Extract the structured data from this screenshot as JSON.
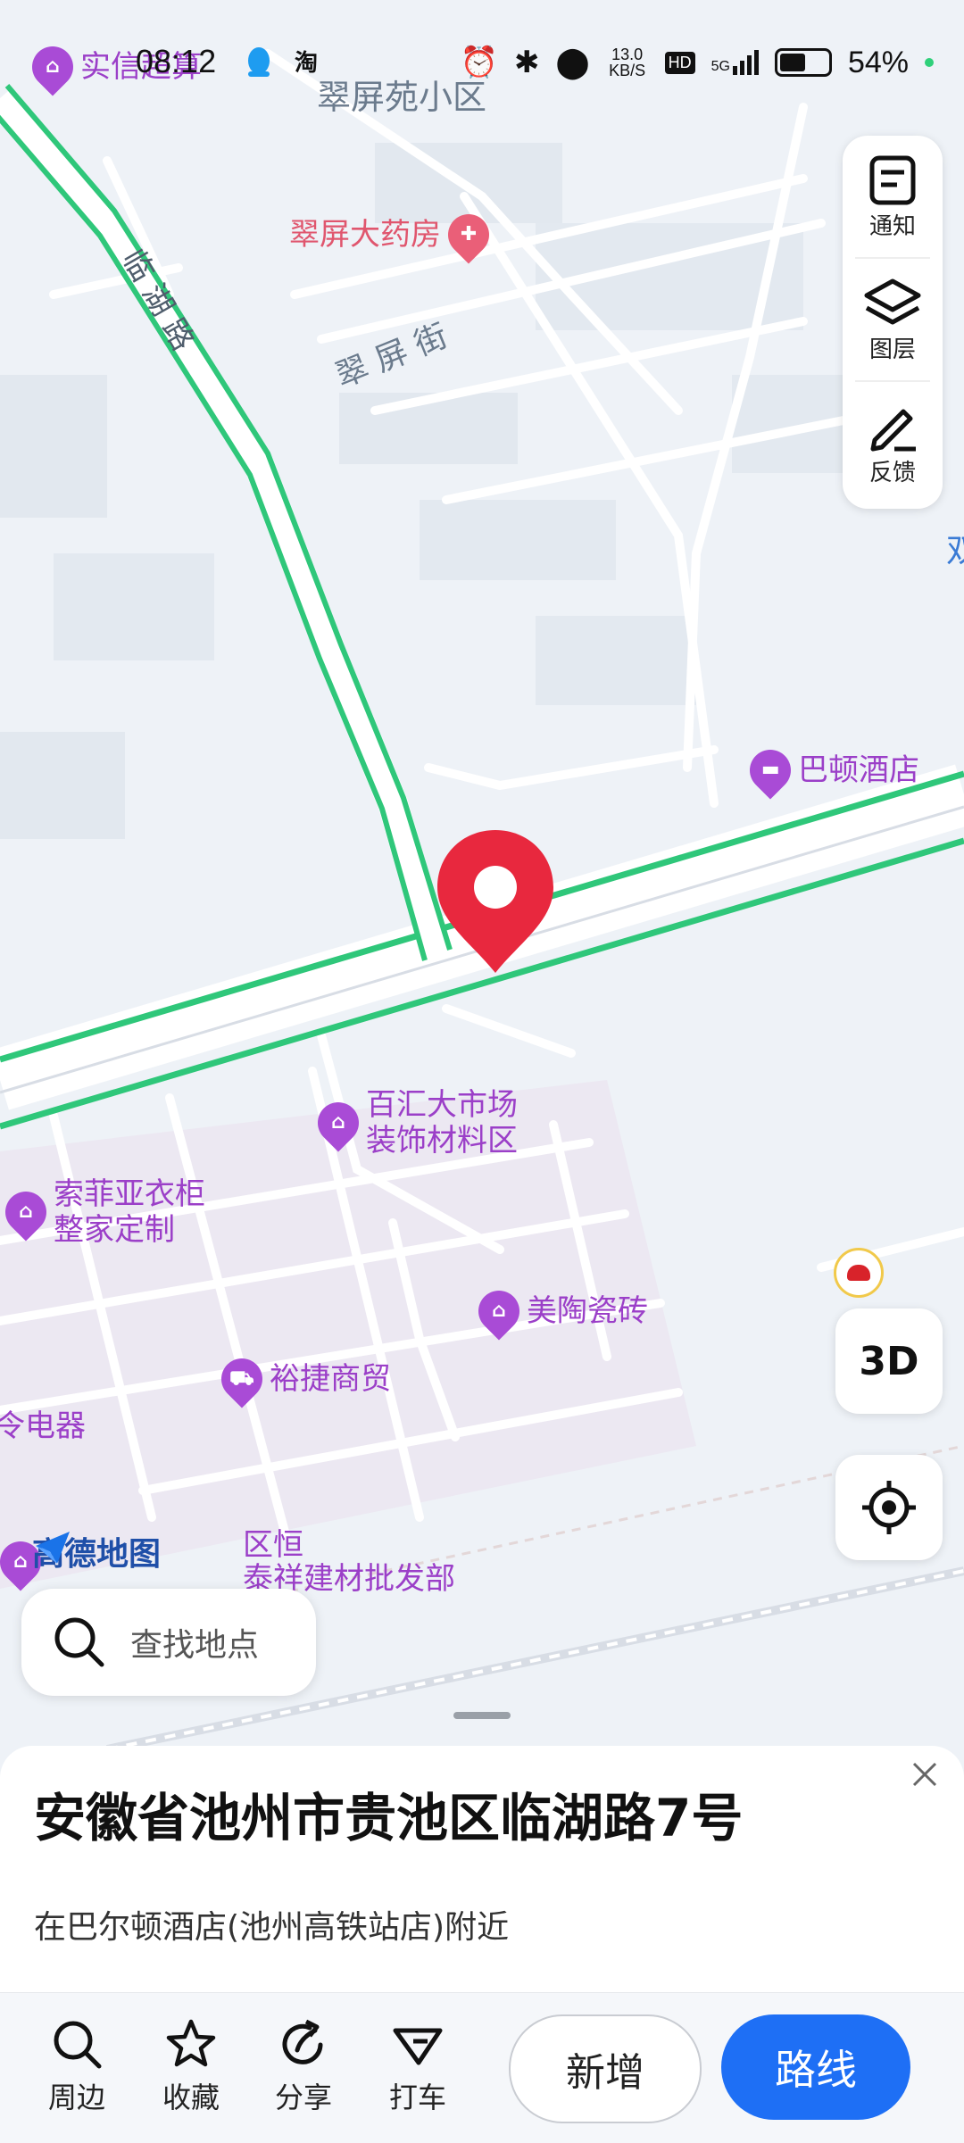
{
  "status": {
    "time": "08:12",
    "net_speed": "13.0 KB/S",
    "hd": "HD",
    "signal": "5G",
    "battery": "54%"
  },
  "map": {
    "labels": {
      "community": "翠屏苑小区",
      "street": "翠 屏 街",
      "road": "临 湖 路",
      "edge_right": "双"
    },
    "pois": [
      {
        "name": "实信超算",
        "type": "shop"
      },
      {
        "name": "翠屏大药房",
        "type": "pharmacy"
      },
      {
        "name": "巴顿酒店",
        "type": "hotel"
      },
      {
        "name": "百汇大市场\n装饰材料区",
        "type": "shop"
      },
      {
        "name": "索菲亚衣柜\n整家定制",
        "type": "shop"
      },
      {
        "name": "美陶瓷砖",
        "type": "shop"
      },
      {
        "name": "裕捷商贸",
        "type": "shop"
      },
      {
        "name": "令电器",
        "type": "shop"
      },
      {
        "name": "区恒\n泰祥建材批发部",
        "type": "shop"
      }
    ],
    "logo": "高德地图"
  },
  "side_panel": {
    "notify": "通知",
    "layers": "图层",
    "feedback": "反馈"
  },
  "controls": {
    "three_d": "3D"
  },
  "search": {
    "placeholder": "查找地点"
  },
  "sheet": {
    "title": "安徽省池州市贵池区临湖路7号",
    "subtitle": "在巴尔顿酒店(池州高铁站店)附近"
  },
  "bottom_bar": {
    "nearby": "周边",
    "favorite": "收藏",
    "share": "分享",
    "taxi": "打车",
    "add": "新增",
    "route": "路线"
  },
  "colors": {
    "road_green": "#2fc77a",
    "poi_purple": "#a94bd6",
    "pin_red": "#e8283e",
    "route_blue": "#1e6ff5"
  }
}
